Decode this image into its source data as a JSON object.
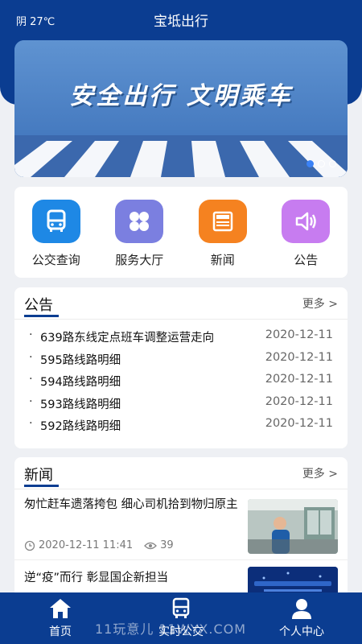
{
  "status": {
    "weather": "阴 27℃",
    "app_title": "宝坻出行"
  },
  "banner": {
    "slogan": "安全出行 文明乘车"
  },
  "services": [
    {
      "label": "公交查询",
      "icon": "bus-icon",
      "color": "#1e88e5"
    },
    {
      "label": "服务大厅",
      "icon": "grid-clover-icon",
      "color": "#7b7fe0"
    },
    {
      "label": "新闻",
      "icon": "newspaper-icon",
      "color": "#f58220"
    },
    {
      "label": "公告",
      "icon": "speaker-icon",
      "color": "#c77cf0"
    }
  ],
  "notices": {
    "title": "公告",
    "more": "更多 >",
    "items": [
      {
        "title": "639路东线定点班车调整运营走向",
        "date": "2020-12-11"
      },
      {
        "title": "595路线路明细",
        "date": "2020-12-11"
      },
      {
        "title": "594路线路明细",
        "date": "2020-12-11"
      },
      {
        "title": "593路线路明细",
        "date": "2020-12-11"
      },
      {
        "title": "592路线路明细",
        "date": "2020-12-11"
      }
    ]
  },
  "news": {
    "title": "新闻",
    "more": "更多 >",
    "items": [
      {
        "title": "匆忙赶车遗落挎包 细心司机拾到物归原主",
        "time": "2020-12-11 11:41",
        "views": "39"
      },
      {
        "title": "逆“疫”而行 彰显国企新担当"
      }
    ]
  },
  "tabbar": {
    "items": [
      {
        "label": "首页",
        "icon": "home-icon"
      },
      {
        "label": "实时公交",
        "icon": "bus-icon"
      },
      {
        "label": "个人中心",
        "icon": "user-icon"
      }
    ],
    "watermark": "11玩意儿 11WYX.COM"
  }
}
